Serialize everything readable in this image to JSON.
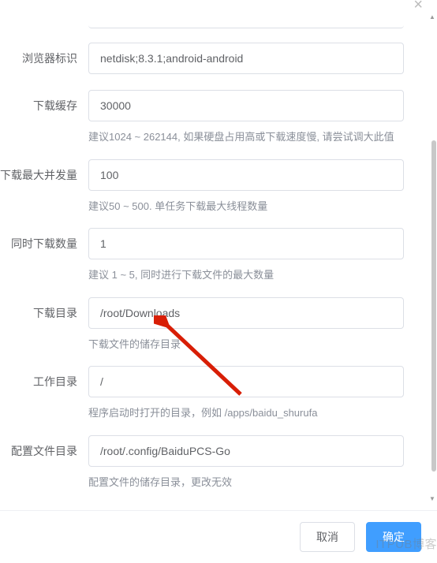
{
  "close": "×",
  "fields": {
    "browser_id": {
      "label": "浏览器标识",
      "value": "netdisk;8.3.1;android-android"
    },
    "cache": {
      "label": "下载缓存",
      "value": "30000",
      "hint": "建议1024 ~ 262144, 如果硬盘占用高或下载速度慢, 请尝试调大此值"
    },
    "parallel": {
      "label": "下载最大并发量",
      "value": "100",
      "hint": "建议50 ~ 500. 单任务下载最大线程数量"
    },
    "concurrent": {
      "label": "同时下载数量",
      "value": "1",
      "hint": "建议 1 ~ 5, 同时进行下载文件的最大数量"
    },
    "download_dir": {
      "label": "下载目录",
      "value": "/root/Downloads",
      "hint": "下载文件的储存目录"
    },
    "work_dir": {
      "label": "工作目录",
      "value": "/",
      "hint": "程序启动时打开的目录，例如 /apps/baidu_shurufa"
    },
    "config_dir": {
      "label": "配置文件目录",
      "value": "/root/.config/BaiduPCS-Go",
      "hint": "配置文件的储存目录，更改无效"
    }
  },
  "footer": {
    "cancel": "取消",
    "confirm": "确定"
  },
  "watermark": "ITPUB博客"
}
